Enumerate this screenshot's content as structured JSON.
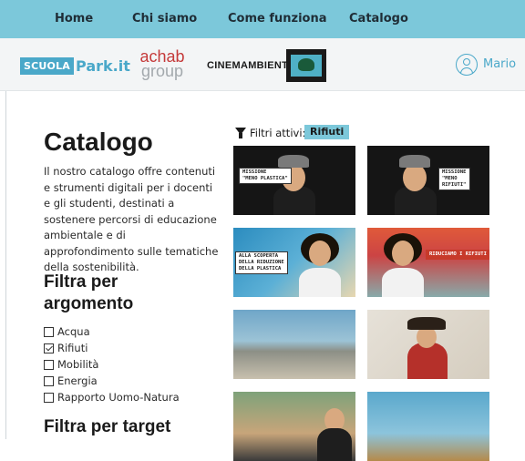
{
  "nav": {
    "items": [
      {
        "label": "Home"
      },
      {
        "label": "Chi siamo"
      },
      {
        "label": "Come funziona"
      },
      {
        "label": "Catalogo"
      }
    ]
  },
  "brand": {
    "scuola_text": "SCUOLA",
    "park_text": "Park.it",
    "achab_line1": "achab",
    "achab_line2": "group",
    "cine_text": "CINEMAMBIENTE"
  },
  "user": {
    "name": "Mario"
  },
  "page": {
    "title": "Catalogo",
    "description": "Il nostro catalogo offre contenuti e strumenti digitali per i docenti e gli studenti, destinati a sostenere percorsi di educazione ambientale e di approfondimento sulle tematiche della sostenibilità."
  },
  "filters": {
    "topic_heading": "Filtra per argomento",
    "topics": [
      {
        "label": "Acqua",
        "checked": false
      },
      {
        "label": "Rifiuti",
        "checked": true
      },
      {
        "label": "Mobilità",
        "checked": false
      },
      {
        "label": "Energia",
        "checked": false
      },
      {
        "label": "Rapporto Uomo-Natura",
        "checked": false
      }
    ],
    "target_heading": "Filtra per target"
  },
  "active_filters": {
    "label": "Filtri attivi:",
    "chips": [
      "Rifiuti"
    ]
  },
  "thumbnails": [
    {
      "caption": "MISSIONE\n\"MENO PLASTICA\""
    },
    {
      "caption": "MISSIONE\n\"MENO\nRIFIUTI\""
    },
    {
      "caption": "ALLA SCOPERTA\nDELLA RIDUZIONE\nDELLA PLASTICA"
    },
    {
      "caption": "RIDUCIAMO I RIFIUTI"
    },
    {
      "caption": ""
    },
    {
      "caption": ""
    },
    {
      "caption": ""
    },
    {
      "caption": ""
    }
  ],
  "colors": {
    "nav_bg": "#7cc8da",
    "accent": "#4aa8c9",
    "chip_bg": "#7cc8da"
  }
}
